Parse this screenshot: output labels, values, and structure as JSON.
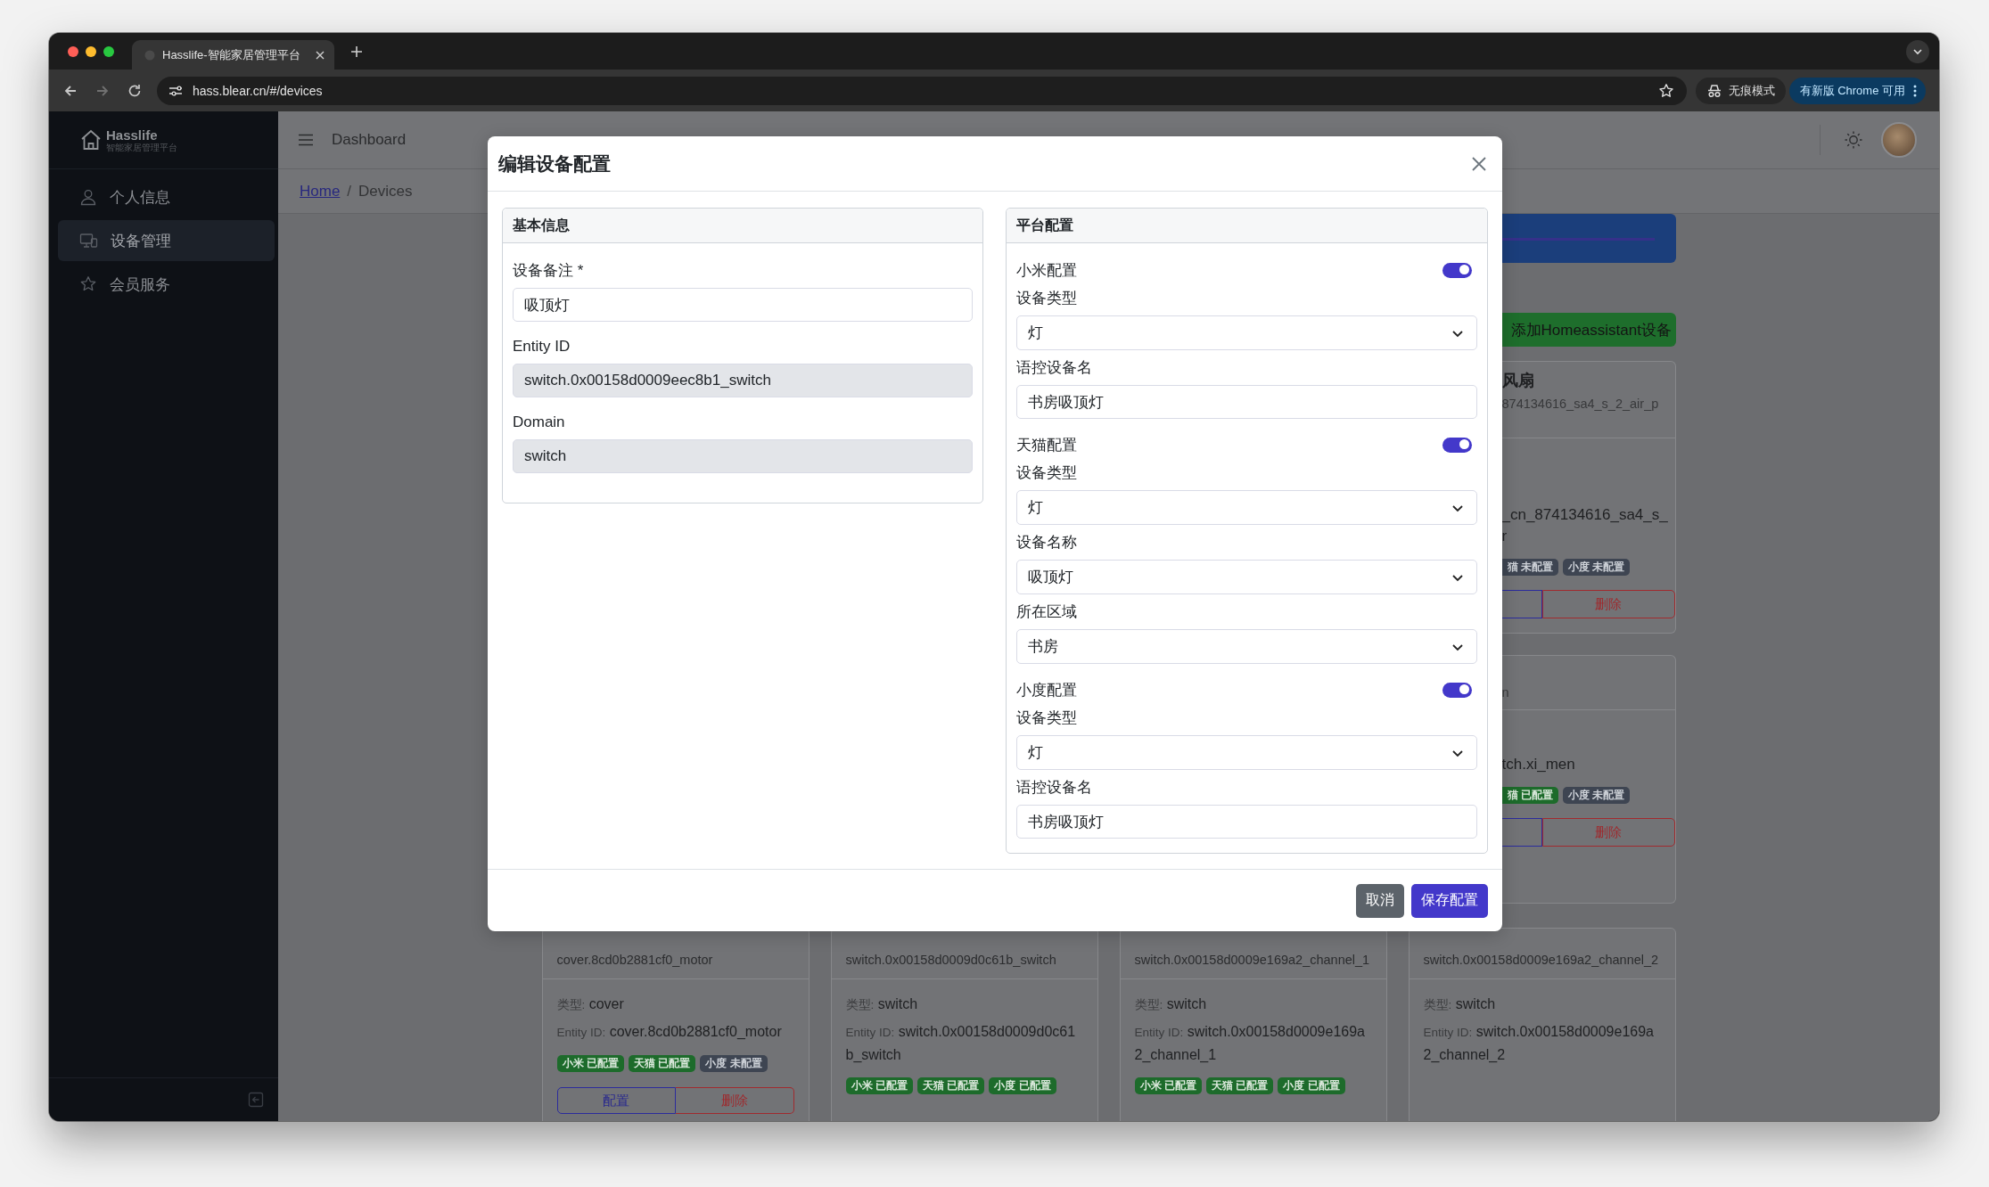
{
  "browser": {
    "tab_title": "Hasslife-智能家居管理平台",
    "url": "hass.blear.cn/#/devices",
    "incognito_label": "无痕模式",
    "update_label": "有新版 Chrome 可用"
  },
  "sidebar": {
    "brand": "Hasslife",
    "brand_subtitle": "智能家居管理平台",
    "items": [
      {
        "label": "个人信息",
        "kind": "person",
        "selected": false
      },
      {
        "label": "设备管理",
        "kind": "devices",
        "selected": true
      },
      {
        "label": "会员服务",
        "kind": "star",
        "selected": false
      }
    ]
  },
  "header": {
    "title": "Dashboard"
  },
  "breadcrumb": {
    "separator": "/",
    "items": [
      {
        "label": "Home",
        "kind": "link"
      },
      {
        "label": "Devices",
        "kind": "current"
      }
    ]
  },
  "side_panel": {
    "add_button": "添加Homeassistant设备",
    "cards": [
      {
        "title": "风扇",
        "subtitle": "874134616_sa4_s_2_air_p",
        "lines": [
          "_cn_874134616_sa4_s_",
          "r"
        ],
        "badges": [
          {
            "label": "猫 未配置",
            "configured": false
          },
          {
            "label": "小度 未配置",
            "configured": false
          }
        ],
        "actions": [
          {
            "kind": "config"
          },
          {
            "label": "删除",
            "kind": "delete"
          }
        ]
      },
      {
        "subtitle": "n",
        "lines": [
          "tch.xi_men"
        ],
        "badges": [
          {
            "label": "猫 已配置",
            "configured": true
          },
          {
            "label": "小度 未配置",
            "configured": false
          }
        ],
        "actions": [
          {
            "kind": "config"
          },
          {
            "label": "删除",
            "kind": "delete"
          }
        ]
      }
    ]
  },
  "device_cards": [
    {
      "entity_line": "cover.8cd0b2881cf0_motor",
      "type_label": "类型:",
      "type_value": "cover",
      "entity_label": "Entity ID:",
      "entity_value": "cover.8cd0b2881cf0_motor",
      "badges": [
        {
          "label": "小米 已配置",
          "configured": true
        },
        {
          "label": "天猫 已配置",
          "configured": true
        },
        {
          "label": "小度 未配置",
          "configured": false
        }
      ],
      "actions": [
        {
          "label": "配置",
          "kind": "config"
        },
        {
          "label": "删除",
          "kind": "delete"
        }
      ]
    },
    {
      "entity_line": "switch.0x00158d0009d0c61b_switch",
      "type_label": "类型:",
      "type_value": "switch",
      "entity_label": "Entity ID:",
      "entity_value": "switch.0x00158d0009d0c61b_switch",
      "badges": [
        {
          "label": "小米 已配置",
          "configured": true
        },
        {
          "label": "天猫 已配置",
          "configured": true
        },
        {
          "label": "小度 已配置",
          "configured": true
        }
      ]
    },
    {
      "entity_line": "switch.0x00158d0009e169a2_channel_1",
      "type_label": "类型:",
      "type_value": "switch",
      "entity_label": "Entity ID:",
      "entity_value": "switch.0x00158d0009e169a2_channel_1",
      "badges": [
        {
          "label": "小米 已配置",
          "configured": true
        },
        {
          "label": "天猫 已配置",
          "configured": true
        },
        {
          "label": "小度 已配置",
          "configured": true
        }
      ]
    },
    {
      "entity_line": "switch.0x00158d0009e169a2_channel_2",
      "type_label": "类型:",
      "type_value": "switch",
      "entity_label": "Entity ID:",
      "entity_value": "switch.0x00158d0009e169a2_channel_2"
    }
  ],
  "modal": {
    "title": "编辑设备配置",
    "basic": {
      "title": "基本信息",
      "fields": [
        {
          "label": "设备备注 *",
          "value": "吸顶灯",
          "disabled": false
        },
        {
          "label": "Entity ID",
          "value": "switch.0x00158d0009eec8b1_switch",
          "disabled": true
        },
        {
          "label": "Domain",
          "value": "switch",
          "disabled": true
        }
      ]
    },
    "platform": {
      "title": "平台配置",
      "sections": [
        {
          "title": "小米配置",
          "enabled": true,
          "fields": [
            {
              "label": "设备类型",
              "kind": "select",
              "value": "灯"
            },
            {
              "label": "语控设备名",
              "kind": "input",
              "value": "书房吸顶灯"
            }
          ]
        },
        {
          "title": "天猫配置",
          "enabled": true,
          "fields": [
            {
              "label": "设备类型",
              "kind": "select",
              "value": "灯"
            },
            {
              "label": "设备名称",
              "kind": "select",
              "value": "吸顶灯"
            },
            {
              "label": "所在区域",
              "kind": "select",
              "value": "书房"
            }
          ]
        },
        {
          "title": "小度配置",
          "enabled": true,
          "fields": [
            {
              "label": "设备类型",
              "kind": "select",
              "value": "灯"
            },
            {
              "label": "语控设备名",
              "kind": "input",
              "value": "书房吸顶灯"
            }
          ]
        }
      ]
    },
    "buttons": [
      {
        "label": "取消",
        "kind": "secondary"
      },
      {
        "label": "保存配置",
        "kind": "primary"
      }
    ]
  }
}
